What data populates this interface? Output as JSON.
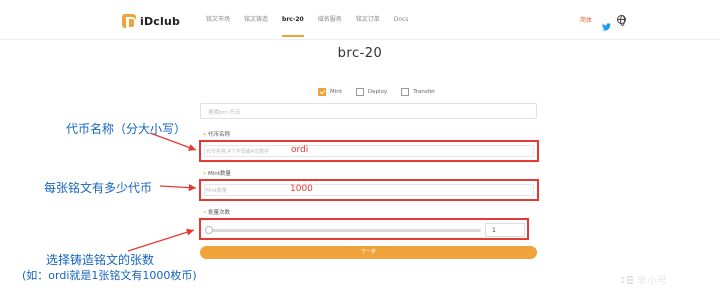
{
  "header": {
    "logo_text": "iDclub",
    "nav": [
      {
        "label": "铭文市场",
        "active": false
      },
      {
        "label": "铭文铸造",
        "active": false
      },
      {
        "label": "brc-20",
        "active": true
      },
      {
        "label": "域名服务",
        "active": false
      },
      {
        "label": "铭文订单",
        "active": false
      },
      {
        "label": "Docs",
        "active": false
      }
    ],
    "lang": "简体",
    "icons": [
      "twitter-icon",
      "globe-icon"
    ]
  },
  "page": {
    "title": "brc-20",
    "options": [
      {
        "label": "Mint",
        "checked": true
      },
      {
        "label": "Deploy",
        "checked": false
      },
      {
        "label": "Transfer",
        "checked": false
      }
    ],
    "search_placeholder": "搜索brc-代币",
    "fields": [
      {
        "label": "代币名称",
        "placeholder": "代币名称,4个字母或4位数字",
        "value": "ordi"
      },
      {
        "label": "Mint数量",
        "placeholder": "Mint数量",
        "value": "1000"
      }
    ],
    "slider": {
      "label": "批量次数",
      "value": "1",
      "level": 0
    },
    "submit_label": "下一步"
  },
  "annotations": {
    "a1": "代币名称（分大小写）",
    "a2": "每张铭文有多少代币",
    "a3_line1": "选择铸造铭文的张数",
    "a3_line2": "(如：ordi就是1张铭文有1000枚币)"
  },
  "watermark": "非小号",
  "colors": {
    "accent": "#f0a23b",
    "annotation": "#1565c0",
    "highlight": "#e53935"
  }
}
